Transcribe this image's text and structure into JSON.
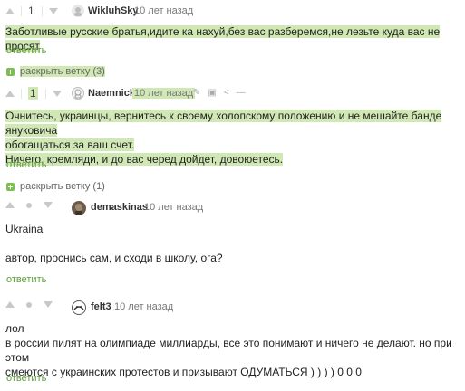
{
  "comments": [
    {
      "score": "1",
      "author": "WikluhSky",
      "time": "10 лет назад",
      "lines": [
        "Заботливые русские братья,идите ка нахуй,без вас разберемся,не лезьте куда вас не просят"
      ],
      "reply": "ответить"
    },
    {
      "expand_label": "раскрыть ветку (3)",
      "score": "1",
      "author": "Naemnick",
      "time": "10 лет назад",
      "lines": [
        "Очнитесь, украинцы, вернитесь к своему холопскому положению и не мешайте банде януковича",
        "обогащаться за ваш счет.",
        "Ничего, кремляди, и до вас черед дойдет, довоюетесь."
      ],
      "reply": "ответить"
    },
    {
      "expand_label": "раскрыть ветку (1)",
      "author": "demaskinas",
      "time": "10 лет назад",
      "lines": [
        "Ukraina",
        "",
        "автор, проснись сам, и сходи в школу, ога?"
      ],
      "reply": "ответить"
    },
    {
      "author": "felt3",
      "time": "10 лет назад",
      "lines": [
        "лол",
        "в россии пилят на олимпиаде миллиарды, все это понимают и ничего не делают. но при этом",
        "смеются с украинских протестов и призывают ОДУМАТЬСЯ ) ) ) ) 0 0 0"
      ],
      "reply": "ответить"
    }
  ],
  "icons": {
    "upvote": "triangle-up",
    "downvote": "triangle-down",
    "neutral": "dot",
    "expand": "plus-square",
    "edit": "pencil-icon",
    "save": "floppy-icon",
    "share": "share-icon",
    "more": "dash-icon"
  },
  "colors": {
    "highlight": "#cfe8b4",
    "reply": "#5f9e3a",
    "plus": "#7cbf50",
    "vote": "#c8c8c8"
  }
}
